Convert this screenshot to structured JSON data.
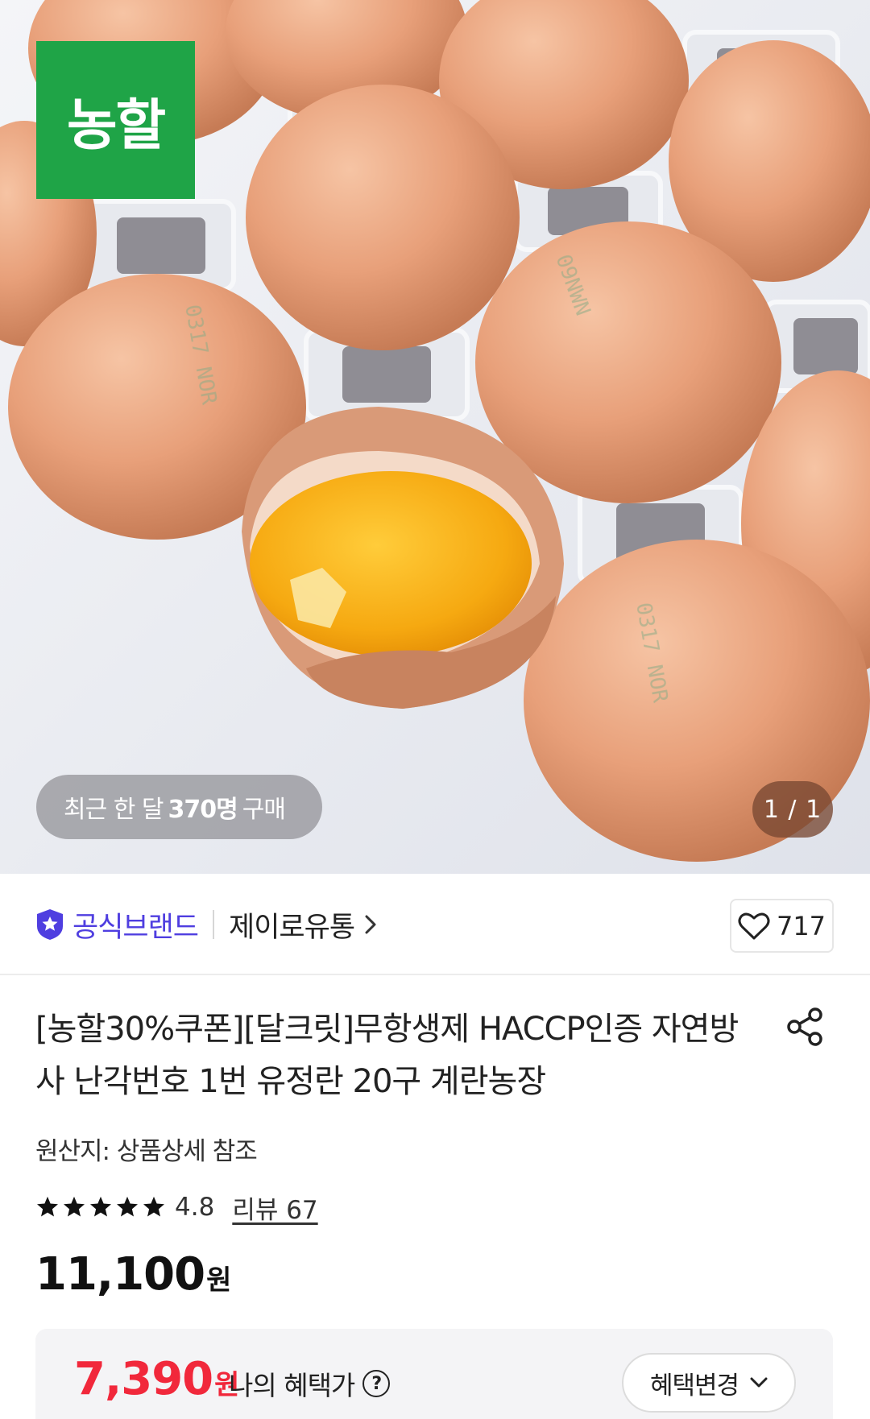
{
  "hero": {
    "logo_text": "농할",
    "recent_badge": {
      "prefix": "최근 한 달",
      "count": "370명",
      "suffix": "구매"
    },
    "pager": "1 / 1"
  },
  "brand_row": {
    "official_label": "공식브랜드",
    "seller_name": "제이로유통",
    "like_count": "717"
  },
  "product": {
    "title": "[농할30%쿠폰][달크릿]무항생제 HACCP인증 자연방사 난각번호 1번 유정란 20구 계란농장",
    "origin": "원산지: 상품상세 참조",
    "rating": {
      "stars": 5,
      "value": "4.8",
      "review_link": "리뷰 67"
    },
    "price": {
      "amount": "11,100",
      "unit": "원"
    }
  },
  "benefit": {
    "amount": "7,390",
    "unit": "원",
    "label": "나의 혜택가",
    "help": "?",
    "change_button": "혜택변경"
  },
  "colors": {
    "logo_green": "#1fa447",
    "brand_purple": "#4f3ee0",
    "benefit_red": "#f1283b"
  },
  "icons": [
    "official-brand-icon",
    "chevron-right-icon",
    "heart-icon",
    "share-icon",
    "star-icon",
    "help-icon",
    "chevron-down-icon"
  ]
}
